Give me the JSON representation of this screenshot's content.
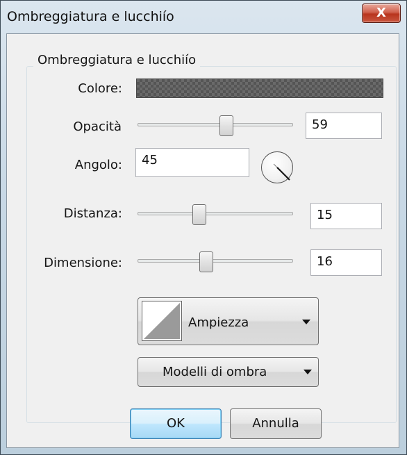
{
  "window": {
    "title": "Ombreggiatura e lucchiío",
    "close_glyph": "X"
  },
  "group": {
    "label": "Ombreggiatura e lucchiío"
  },
  "fields": {
    "color": {
      "label": "Colore:"
    },
    "opacity": {
      "label": "Opacità",
      "value": "59",
      "slider_fraction": 0.59
    },
    "angle": {
      "label": "Angolo:",
      "value": "45",
      "dial_icon": "angle-dial-icon"
    },
    "distance": {
      "label": "Distanza:",
      "value": "15",
      "slider_fraction": 0.3
    },
    "size": {
      "label": "Dimensione:",
      "value": "16",
      "slider_fraction": 0.4
    }
  },
  "shape_dropdown": {
    "label": "Ampiezza",
    "icon": "triangle-shape-icon"
  },
  "shadow_models_dropdown": {
    "label": "Modelli di ombra"
  },
  "buttons": {
    "ok": "OK",
    "cancel": "Annulla"
  }
}
